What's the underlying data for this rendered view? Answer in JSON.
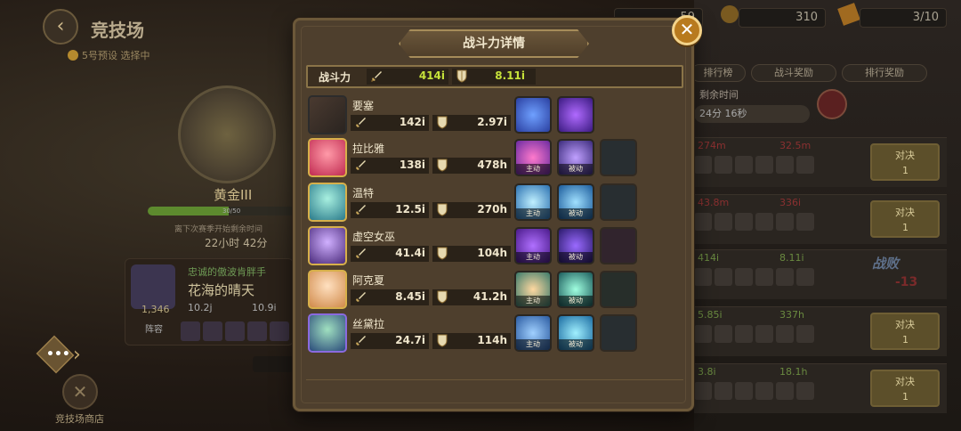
{
  "background": {
    "screen_title": "竞技场",
    "preset_label": "5号预设 选择中",
    "rank": "黄金III",
    "progress_text": "30/50",
    "progress_value": 0.6,
    "season_label": "离下次赛季开始剩余时间",
    "season_time": "22小时 42分",
    "player_card": {
      "guild": "忠诚的傲波肯胖手",
      "name": "花海的晴天",
      "score": "1,346",
      "atk": "10.2j",
      "def": "10.9i",
      "slot_label": "阵容"
    },
    "shop_label": "竞技场商店",
    "top_counter_1": "59",
    "top_counter_2": "310",
    "top_counter_3": "3/10",
    "tabs": [
      "排行榜",
      "战斗奖励",
      "排行奖励"
    ],
    "remain_label": "剩余时间",
    "remain_time": "24分 16秒",
    "opponents": [
      {
        "atk": "274m",
        "def": "32.5m",
        "btn_label": "对决",
        "btn_count": "1"
      },
      {
        "atk": "43.8m",
        "def": "336i",
        "btn_label": "对决",
        "btn_count": "1"
      },
      {
        "atk": "414i",
        "def": "8.11i",
        "result": "战败",
        "result_value": "-13"
      },
      {
        "atk": "5.85i",
        "def": "337h",
        "btn_label": "对决",
        "btn_count": "1"
      },
      {
        "atk": "3.8i",
        "def": "18.1h",
        "btn_label": "对决",
        "btn_count": "1"
      }
    ]
  },
  "modal": {
    "title": "战斗力详情",
    "summary": {
      "label": "战斗力",
      "atk": "414i",
      "def": "8.11i"
    },
    "tag_active": "主动",
    "tag_passive": "被动",
    "heroes": [
      {
        "name": "要塞",
        "atk": "142i",
        "def": "2.97i"
      },
      {
        "name": "拉比雅",
        "atk": "138i",
        "def": "478h"
      },
      {
        "name": "温特",
        "atk": "12.5i",
        "def": "270h"
      },
      {
        "name": "虚空女巫",
        "atk": "41.4i",
        "def": "104h"
      },
      {
        "name": "阿克夏",
        "atk": "8.45i",
        "def": "41.2h"
      },
      {
        "name": "丝黛拉",
        "atk": "24.7i",
        "def": "114h"
      }
    ]
  },
  "colors": {
    "accent_green": "#c6e23a",
    "panel": "#4e3f2d",
    "gold": "#d7b04a"
  }
}
